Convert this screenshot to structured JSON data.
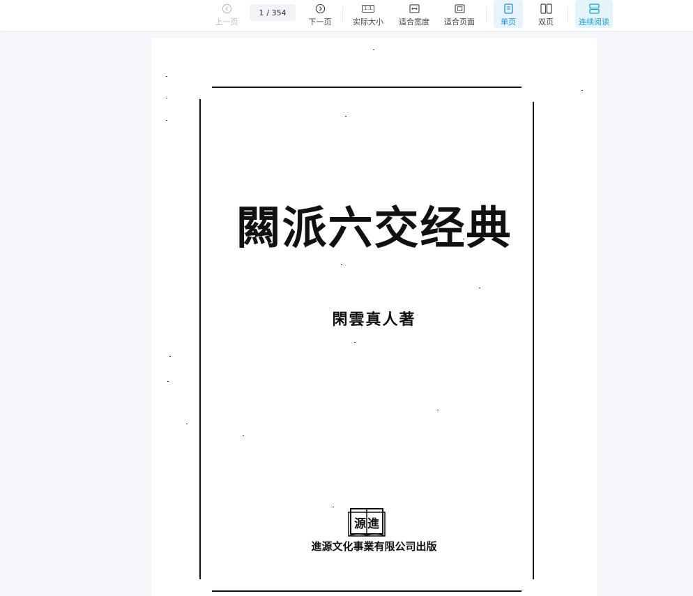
{
  "toolbar": {
    "prev_label": "上一页",
    "next_label": "下一页",
    "current_page": "1",
    "total_pages": "/ 354",
    "actual_size_label": "实际大小",
    "actual_size_icon_text": "1:1",
    "fit_width_label": "适合宽度",
    "fit_page_label": "适合页面",
    "single_page_label": "单页",
    "double_page_label": "双页",
    "continuous_label": "连续阅读",
    "accent_color": "#1a8ee0"
  },
  "document": {
    "title": "闗派六交经典",
    "author": "閑雲真人著",
    "logo_text": "源進",
    "publisher": "進源文化事業有限公司出版"
  }
}
